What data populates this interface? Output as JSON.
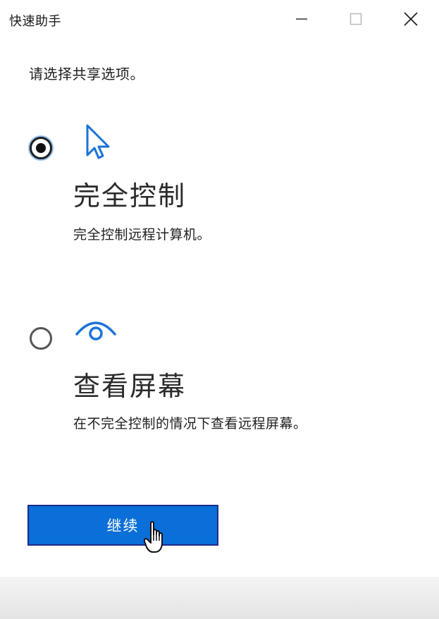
{
  "window": {
    "title": "快速助手",
    "controls": {
      "minimize_icon": "minimize-icon",
      "maximize_icon": "maximize-icon",
      "close_icon": "close-icon"
    }
  },
  "main": {
    "prompt": "请选择共享选项。",
    "options": [
      {
        "icon": "pointer-arrow-icon",
        "title": "完全控制",
        "description": "完全控制远程计算机。",
        "selected": true
      },
      {
        "icon": "eye-view-icon",
        "title": "查看屏幕",
        "description": "在不完全控制的情况下查看远程屏幕。",
        "selected": false
      }
    ],
    "continue_label": "继续"
  },
  "colors": {
    "accent": "#0a6fd8",
    "button_border": "#1b2c8a",
    "focus_ring": "#3c8de0"
  }
}
